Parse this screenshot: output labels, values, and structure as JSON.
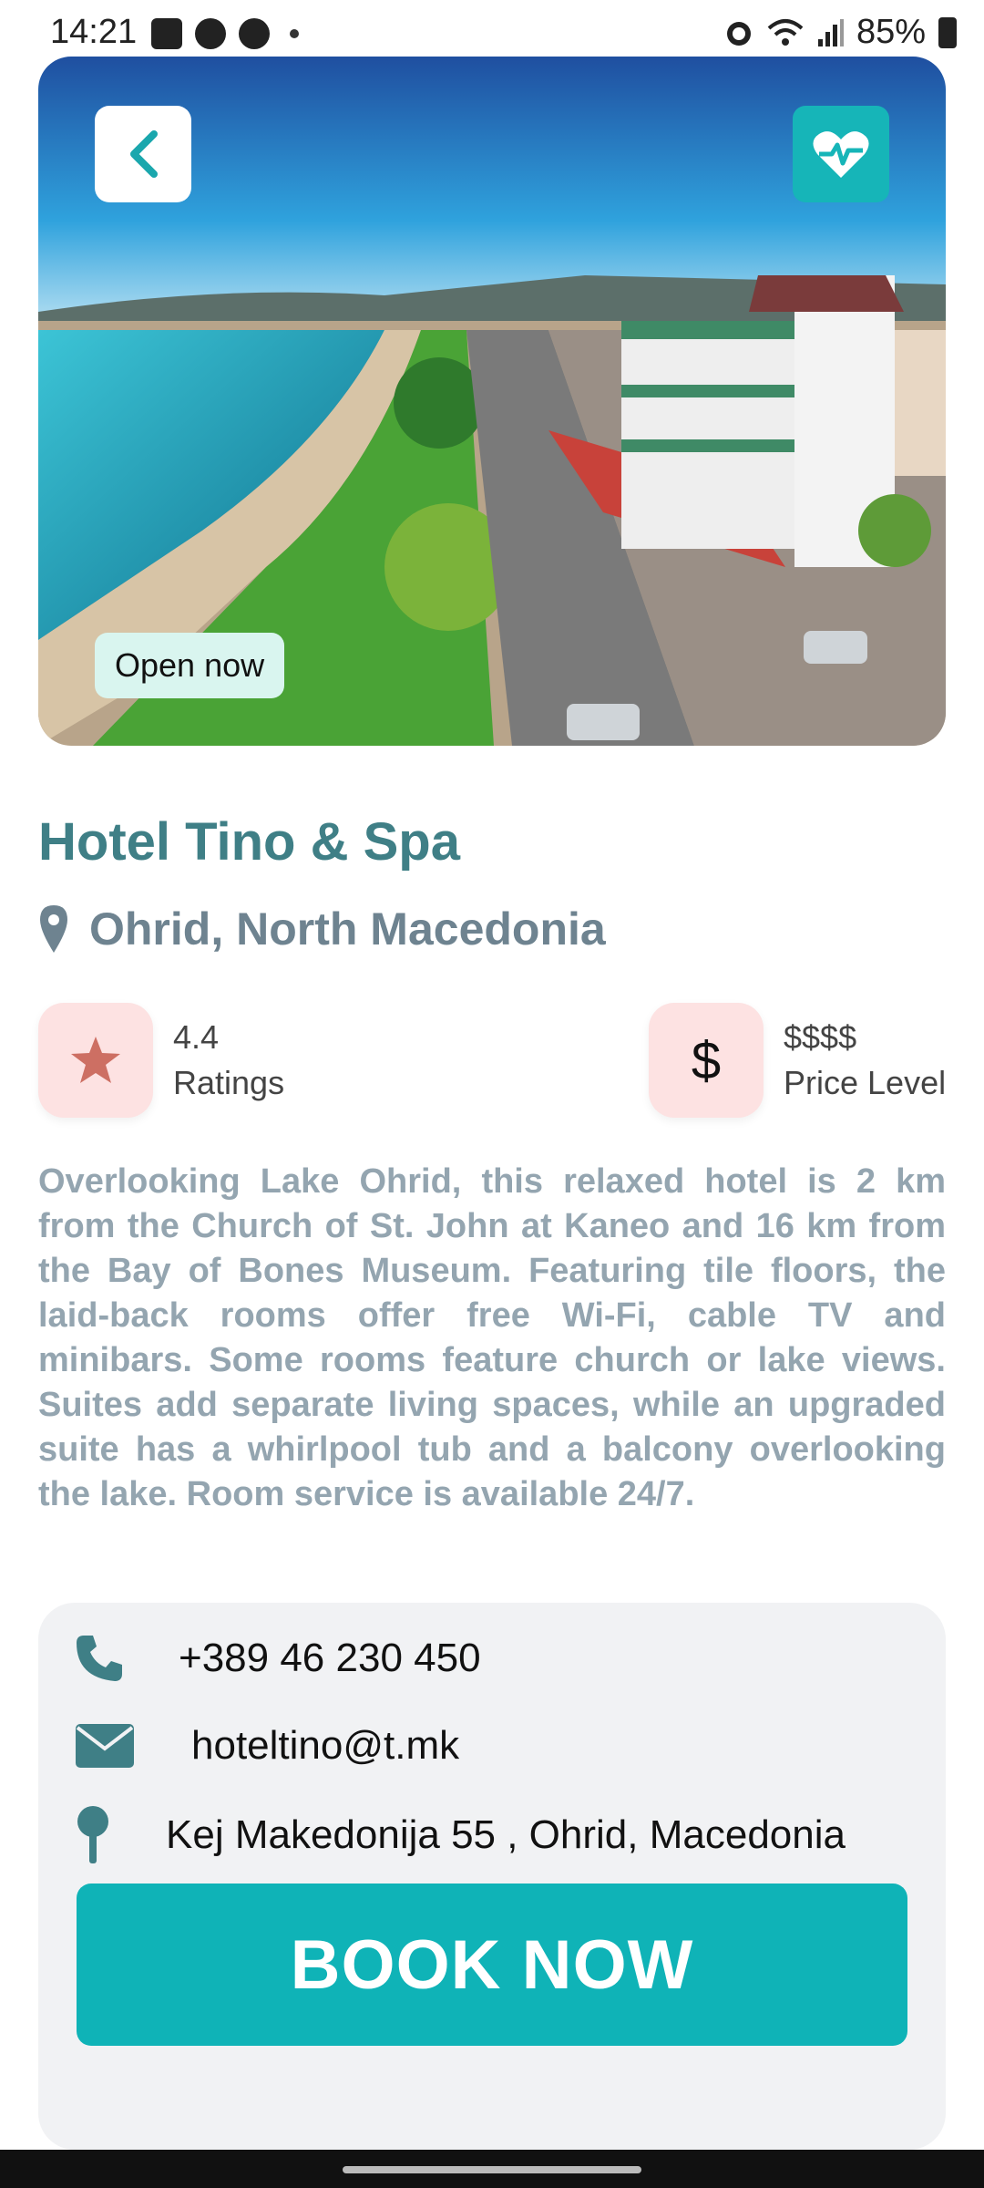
{
  "status_bar": {
    "time": "14:21",
    "battery": "85%"
  },
  "hero": {
    "badge": "Open now"
  },
  "hotel": {
    "name": "Hotel Tino & Spa",
    "location": "Ohrid, North Macedonia",
    "rating_value": "4.4",
    "rating_label": "Ratings",
    "price_value": "$$$$",
    "price_label": "Price Level",
    "price_symbol": "$",
    "description": "Overlooking Lake Ohrid, this relaxed hotel is 2 km from the Church of St. John at Kaneo and 16 km from the Bay of Bones Museum. Featuring tile floors, the laid-back rooms offer free Wi-Fi, cable TV and minibars. Some rooms feature church or lake views. Suites add separate living spaces, while an upgraded suite has a whirlpool tub and a balcony overlooking the lake. Room service is available 24/7."
  },
  "contact": {
    "phone": "+389 46 230 450",
    "email": "hoteltino@t.mk",
    "address": "Kej Makedonija 55 , Ohrid, Macedonia"
  },
  "actions": {
    "book_label": "BOOK NOW"
  },
  "colors": {
    "accent": "#0fb3b7",
    "title": "#3f7f86",
    "muted": "#94a5b0",
    "icon_bg": "#fde2e2",
    "star": "#cd6f63"
  },
  "icons": [
    "chevron-left-icon",
    "heart-pulse-icon",
    "map-pin-icon",
    "star-icon",
    "phone-icon",
    "envelope-icon",
    "pushpin-icon"
  ]
}
